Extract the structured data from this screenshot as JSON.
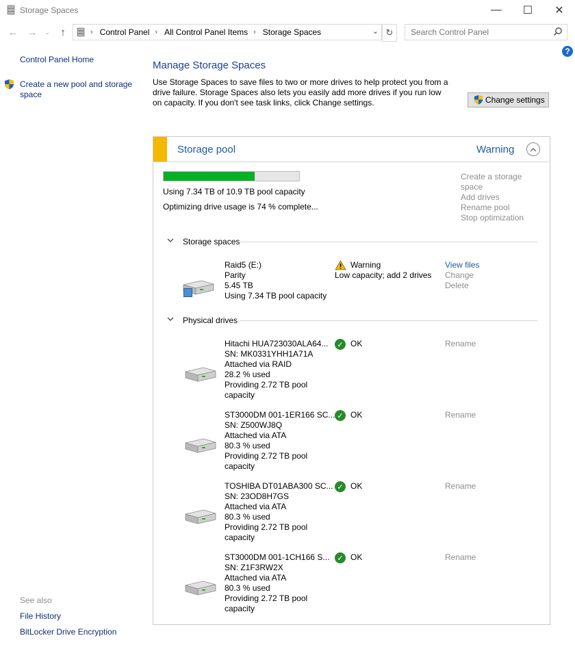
{
  "window": {
    "title": "Storage Spaces",
    "minimize": "—",
    "maximize": "☐",
    "close": "✕"
  },
  "address": {
    "crumbs": [
      "Control Panel",
      "All Control Panel Items",
      "Storage Spaces"
    ],
    "search_placeholder": "Search Control Panel"
  },
  "sidebar": {
    "home": "Control Panel Home",
    "create_pool": "Create a new pool and storage space",
    "see_also": "See also",
    "links": [
      "File History",
      "BitLocker Drive Encryption"
    ]
  },
  "main": {
    "heading": "Manage Storage Spaces",
    "description": "Use Storage Spaces to save files to two or more drives to help protect you from a drive failure. Storage Spaces also lets you easily add more drives if you run low on capacity. If you don't see task links, click Change settings.",
    "change_settings": "Change settings"
  },
  "pool": {
    "title": "Storage pool",
    "status": "Warning",
    "accent_color": "#f5b800",
    "usage_fraction": 0.673,
    "usage_text": "Using 7.34 TB of 10.9 TB pool capacity",
    "optimizing_text": "Optimizing drive usage is 74 % complete...",
    "actions": [
      "Create a storage space",
      "Add drives",
      "Rename pool",
      "Stop optimization"
    ]
  },
  "spaces": {
    "label": "Storage spaces",
    "item": {
      "name": "Raid5 (E:)",
      "type": "Parity",
      "size": "5.45 TB",
      "usage": "Using 7.34 TB pool capacity",
      "status": "Warning",
      "status_detail": "Low capacity; add 2 drives",
      "actions": [
        "View files",
        "Change",
        "Delete"
      ]
    }
  },
  "drives": {
    "label": "Physical drives",
    "rename": "Rename",
    "items": [
      {
        "name": "Hitachi HUA723030ALA64...",
        "sn": "SN: MK0331YHH1A71A",
        "attach": "Attached via RAID",
        "used": "28.2 % used",
        "providing": "Providing 2.72 TB pool",
        "capacity": "capacity",
        "status": "OK"
      },
      {
        "name": "ST3000DM 001-1ER166 SC...",
        "sn": "SN: Z500WJ8Q",
        "attach": "Attached via ATA",
        "used": "80.3 % used",
        "providing": "Providing 2.72 TB pool",
        "capacity": "capacity",
        "status": "OK"
      },
      {
        "name": "TOSHIBA DT01ABA300 SC...",
        "sn": "SN: 23OD8H7GS",
        "attach": "Attached via ATA",
        "used": "80.3 % used",
        "providing": "Providing 2.72 TB pool",
        "capacity": "capacity",
        "status": "OK"
      },
      {
        "name": "ST3000DM 001-1CH166 S...",
        "sn": "SN: Z1F3RW2X",
        "attach": "Attached via ATA",
        "used": "80.3 % used",
        "providing": "Providing 2.72 TB pool",
        "capacity": "capacity",
        "status": "OK"
      }
    ]
  }
}
